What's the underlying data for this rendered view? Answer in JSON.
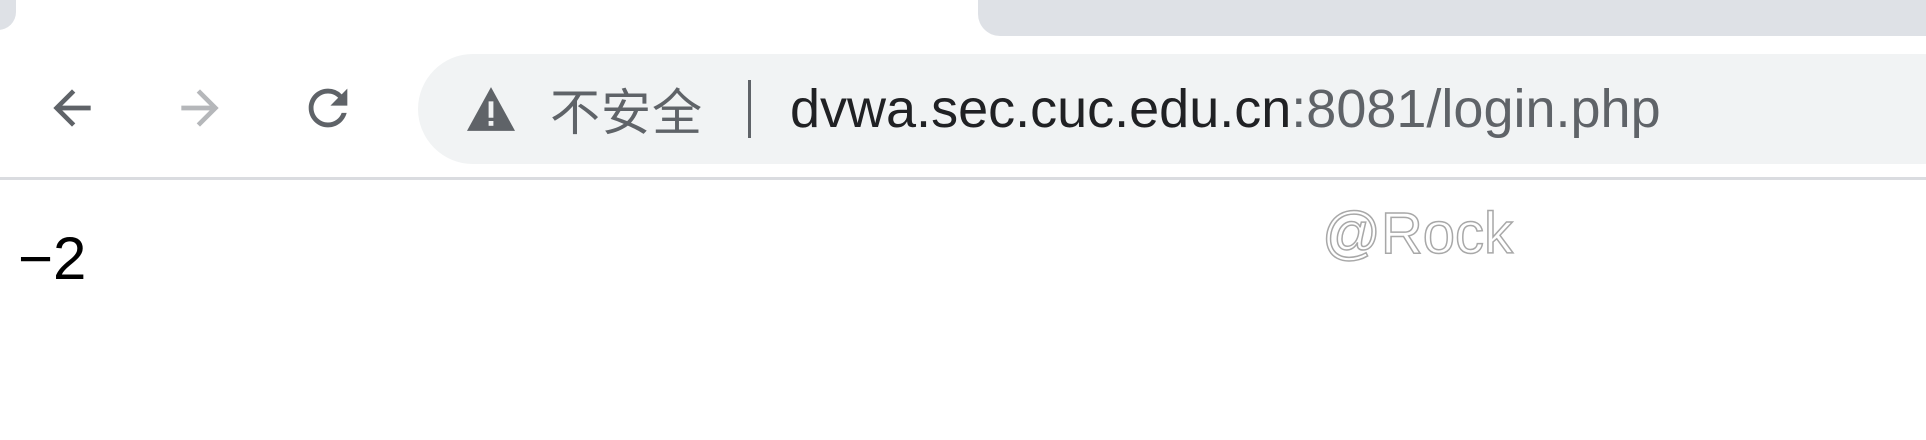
{
  "toolbar": {
    "back_icon": "arrow-left-icon",
    "forward_icon": "arrow-right-icon",
    "reload_icon": "reload-icon",
    "forward_enabled": false
  },
  "omnibox": {
    "security_icon": "warning-triangle-icon",
    "security_text": "不安全",
    "url_host": "dvwa.sec.cuc.edu.cn",
    "url_rest": ":8081/login.php"
  },
  "page": {
    "body_text": "−2"
  },
  "watermark": {
    "text": "@Rock"
  },
  "colors": {
    "tabstrip_tab": "#dee1e6",
    "omnibox_bg": "#f1f3f4",
    "icon_active": "#5f6368",
    "icon_disabled": "#b5b7ba",
    "url_host": "#202124",
    "url_rest": "#5f6368"
  }
}
